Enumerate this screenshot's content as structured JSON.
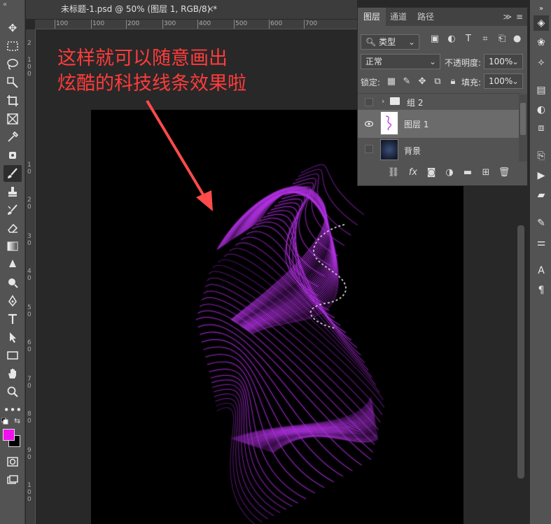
{
  "document": {
    "tab_title": "未标题-1.psd @ 50% (图层 1, RGB/8) *",
    "close": "×"
  },
  "ruler": {
    "top": [
      "100",
      "100",
      "200",
      "300",
      "400",
      "500",
      "600",
      "700"
    ],
    "left": [
      "2",
      "1",
      "0",
      "0",
      "1",
      "0",
      "2",
      "0",
      "3",
      "0",
      "4",
      "0",
      "5",
      "0",
      "6",
      "0",
      "7",
      "0",
      "8",
      "0",
      "9",
      "0",
      "1",
      "0",
      "0"
    ]
  },
  "annotation": {
    "line1": "这样就可以随意画出",
    "line2": "炫酷的科技线条效果啦"
  },
  "colors": {
    "foreground": "#ee11ee",
    "background": "#000000",
    "ribbon": "#b030e0"
  },
  "layers_panel": {
    "tabs": [
      "图层",
      "通道",
      "路径"
    ],
    "active_tab": "图层",
    "expand": "≫",
    "menu": "≡",
    "filter_kind": "类型",
    "blend_mode": "正常",
    "opacity_label": "不透明度:",
    "opacity_value": "100%",
    "lock_label": "锁定:",
    "fill_label": "填充:",
    "fill_value": "100%",
    "layers": [
      {
        "name": "组 2",
        "type": "group",
        "visible": false
      },
      {
        "name": "图层 1",
        "type": "layer",
        "visible": true,
        "selected": true
      },
      {
        "name": "背景",
        "type": "background",
        "visible": false
      }
    ]
  }
}
